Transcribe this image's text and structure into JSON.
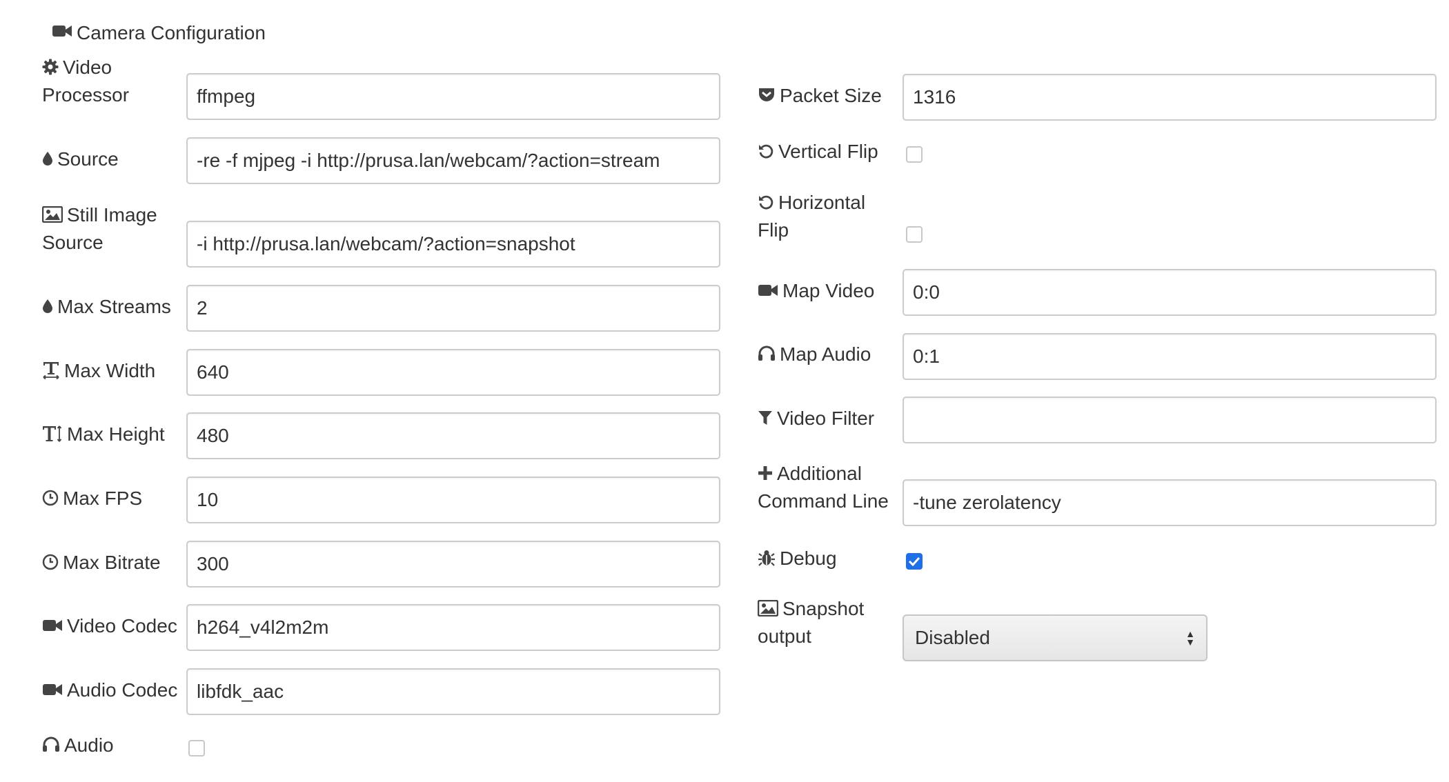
{
  "title": {
    "icon": "video-camera-icon",
    "text": "Camera Configuration"
  },
  "left": {
    "video_processor": {
      "icon": "gear-icon",
      "label": "Video Processor",
      "value": "ffmpeg"
    },
    "source": {
      "icon": "droplet-icon",
      "label": "Source",
      "value": "-re -f mjpeg -i http://prusa.lan/webcam/?action=stream"
    },
    "still_image_source": {
      "icon": "image-icon",
      "label": "Still Image Source",
      "value": "-i http://prusa.lan/webcam/?action=snapshot"
    },
    "max_streams": {
      "icon": "droplet-icon",
      "label": "Max Streams",
      "value": "2"
    },
    "max_width": {
      "icon": "text-width-icon",
      "label": "Max Width",
      "value": "640"
    },
    "max_height": {
      "icon": "text-height-icon",
      "label": "Max Height",
      "value": "480"
    },
    "max_fps": {
      "icon": "clock-icon",
      "label": "Max FPS",
      "value": "10"
    },
    "max_bitrate": {
      "icon": "clock-icon",
      "label": "Max Bitrate",
      "value": "300"
    },
    "video_codec": {
      "icon": "video-camera-icon",
      "label": "Video Codec",
      "value": "h264_v4l2m2m"
    },
    "audio_codec": {
      "icon": "video-camera-icon",
      "label": "Audio Codec",
      "value": "libfdk_aac"
    },
    "audio": {
      "icon": "headphones-icon",
      "label": "Audio",
      "checked": false
    }
  },
  "right": {
    "packet_size": {
      "icon": "pocket-icon",
      "label": "Packet Size",
      "value": "1316"
    },
    "vertical_flip": {
      "icon": "rotate-icon",
      "label": "Vertical Flip",
      "checked": false
    },
    "horizontal_flip": {
      "icon": "rotate-icon",
      "label": "Horizontal Flip",
      "checked": false
    },
    "map_video": {
      "icon": "video-camera-icon",
      "label": "Map Video",
      "value": "0:0"
    },
    "map_audio": {
      "icon": "headphones-icon",
      "label": "Map Audio",
      "value": "0:1"
    },
    "video_filter": {
      "icon": "filter-icon",
      "label": "Video Filter",
      "value": ""
    },
    "additional_command_line": {
      "icon": "plus-icon",
      "label": "Additional Command Line",
      "value": "-tune zerolatency"
    },
    "debug": {
      "icon": "bug-icon",
      "label": "Debug",
      "checked": true
    },
    "snapshot_output": {
      "icon": "image-icon",
      "label": "Snapshot output",
      "value": "Disabled",
      "options": [
        "Disabled"
      ]
    }
  },
  "colors": {
    "checkbox_checked": "#1e6fe8",
    "border": "#cccccc",
    "text": "#333333"
  }
}
